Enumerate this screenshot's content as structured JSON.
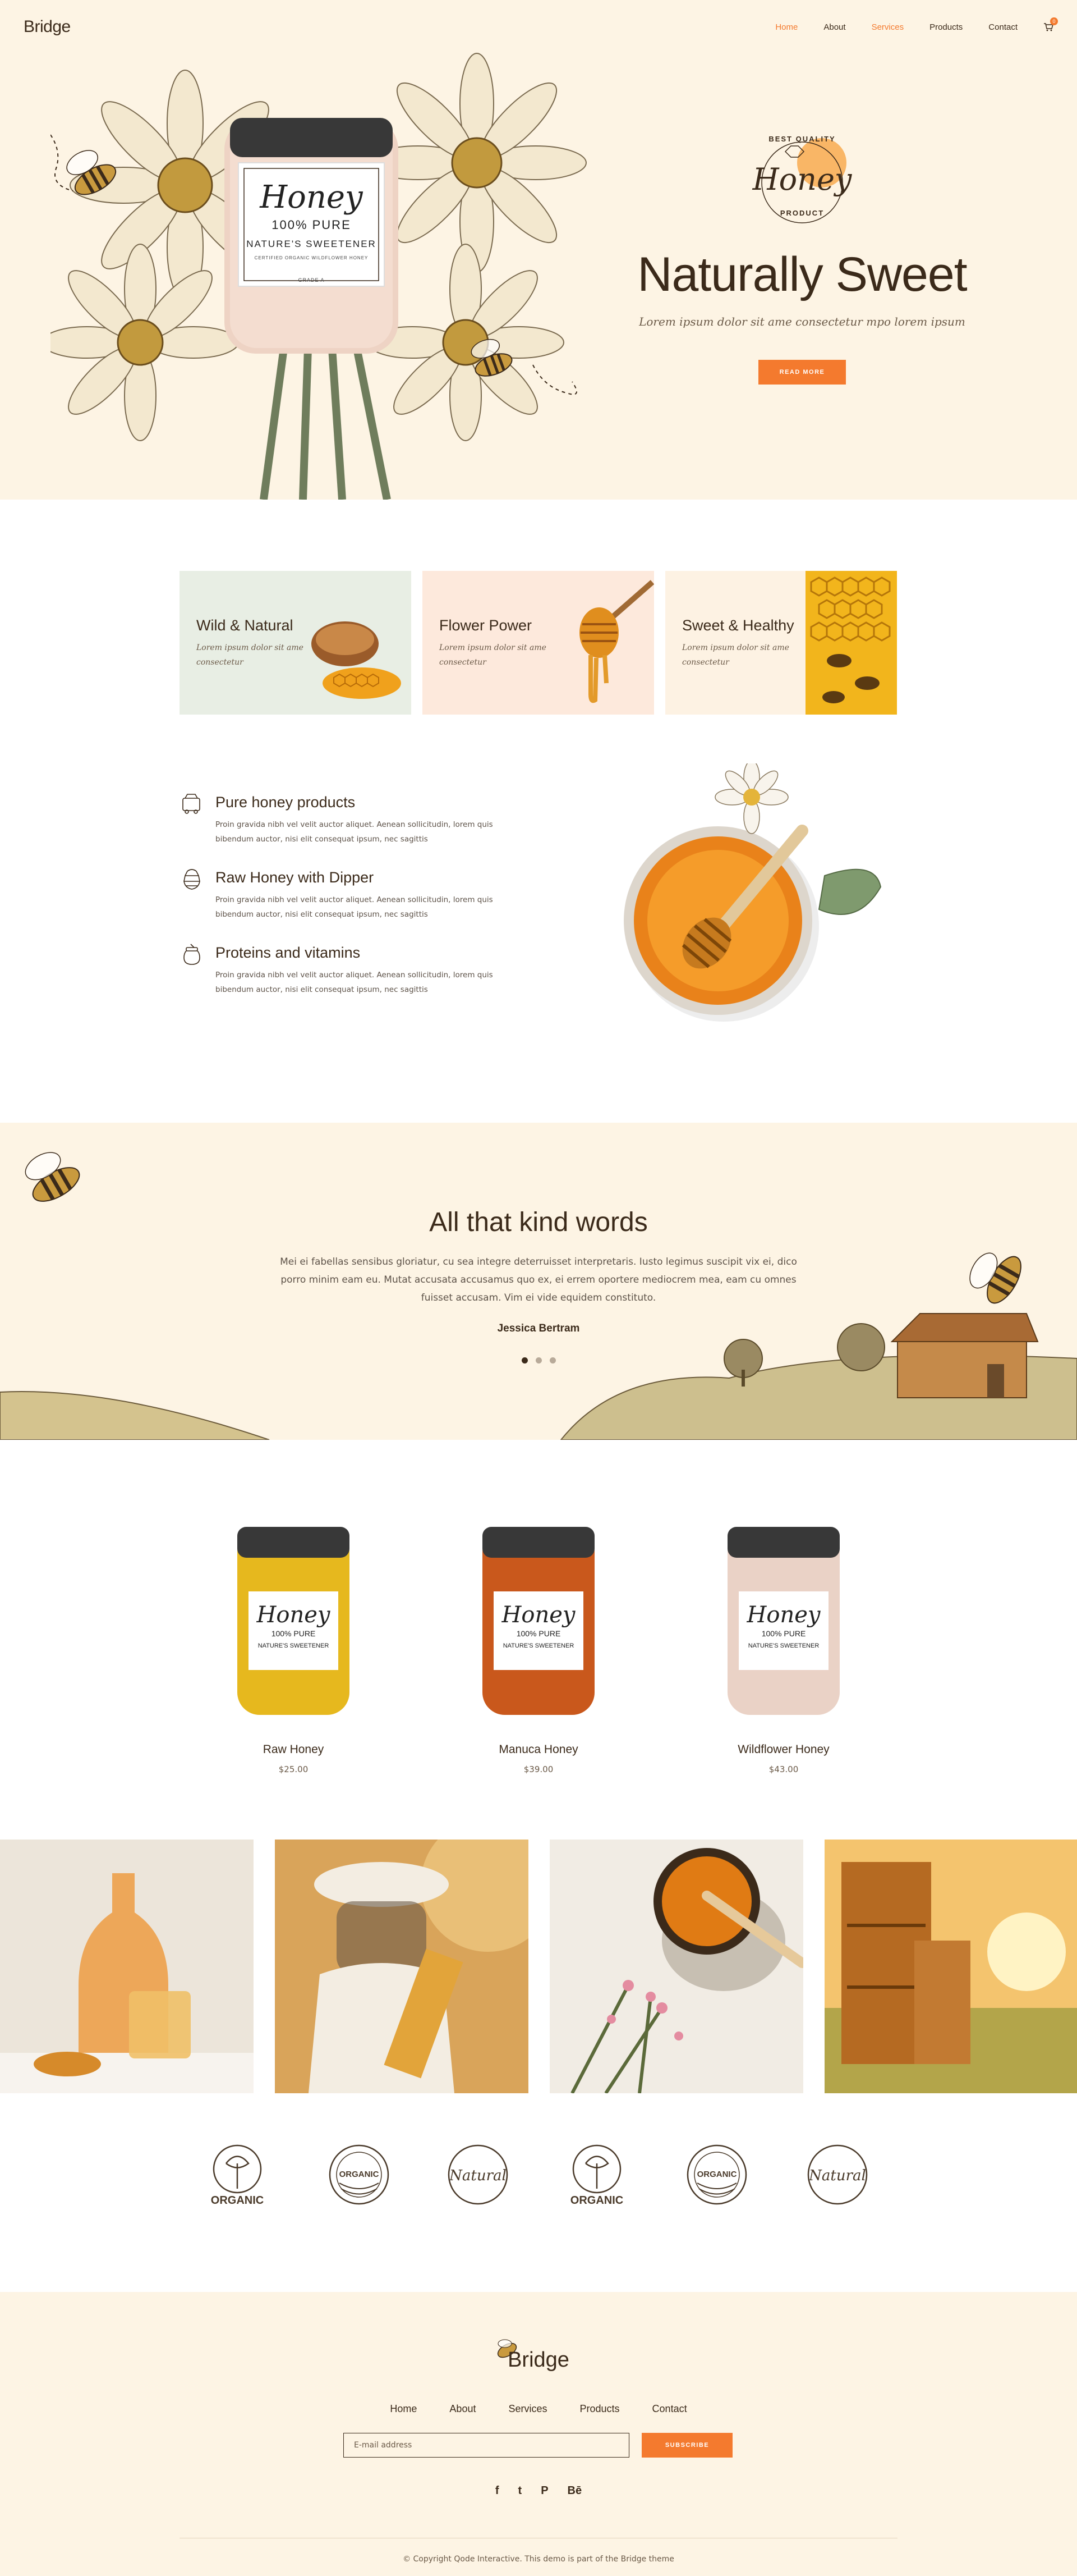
{
  "header": {
    "logo": "Bridge",
    "nav": [
      "Home",
      "About",
      "Services",
      "Products",
      "Contact"
    ],
    "cart_count": "0",
    "colors": {
      "accent": "#f47a2e",
      "text": "#3b2a1a",
      "cream": "#fdf4e4"
    }
  },
  "hero": {
    "jar": {
      "brand": "Honey",
      "line1": "100% PURE",
      "line2": "NATURE'S SWEETENER",
      "line3": "CERTIFIED ORGANIC WILDFLOWER HONEY",
      "line4": "GRADE A"
    },
    "badge": {
      "top": "BEST QUALITY",
      "middle": "Honey",
      "bottom": "PRODUCT"
    },
    "title": "Naturally Sweet",
    "subtitle": "Lorem ipsum dolor sit ame consectetur mpo lorem ipsum",
    "button": "READ MORE"
  },
  "features": [
    {
      "title": "Wild & Natural",
      "text": "Lorem ipsum dolor sit ame consectetur",
      "bg": "#e8eee4"
    },
    {
      "title": "Flower Power",
      "text": "Lorem ipsum dolor sit ame consectetur",
      "bg": "#fde9dc"
    },
    {
      "title": "Sweet & Healthy",
      "text": "Lorem ipsum dolor sit ame consectetur",
      "bg": "#fdf2e3"
    }
  ],
  "info": [
    {
      "title": "Pure honey products",
      "text": "Proin gravida nibh vel velit auctor aliquet. Aenean sollicitudin, lorem quis bibendum auctor, nisi elit consequat ipsum, nec sagittis",
      "icon": "honey-truck-icon"
    },
    {
      "title": "Raw Honey with Dipper",
      "text": "Proin gravida nibh vel velit auctor aliquet. Aenean sollicitudin, lorem quis bibendum auctor, nisi elit consequat ipsum, nec sagittis",
      "icon": "beehive-icon"
    },
    {
      "title": "Proteins and vitamins",
      "text": "Proin gravida nibh vel velit auctor aliquet. Aenean sollicitudin, lorem quis bibendum auctor, nisi elit consequat ipsum, nec sagittis",
      "icon": "honey-jar-icon"
    }
  ],
  "testimonial": {
    "title": "All that kind words",
    "text": "Mei ei fabellas sensibus gloriatur, cu sea integre deterruisset interpretaris. Iusto legimus suscipit vix ei, dico porro minim eam eu. Mutat accusata accusamus quo ex, ei errem oportere mediocrem mea, eam cu omnes fuisset accusam. Vim ei vide equidem constituto.",
    "author": "Jessica Bertram",
    "slides": 3,
    "active_slide": 1
  },
  "products": [
    {
      "name": "Raw Honey",
      "price": "$25.00",
      "color": "#e6b81e"
    },
    {
      "name": "Manuca Honey",
      "price": "$39.00",
      "color": "#c9581c"
    },
    {
      "name": "Wildflower Honey",
      "price": "$43.00",
      "color": "#ead2c6"
    }
  ],
  "jar_label": {
    "brand": "Honey",
    "line1": "100% PURE",
    "line2": "NATURE'S SWEETENER"
  },
  "brands": [
    "ORGANIC",
    "ORGANIC",
    "Natural",
    "ORGANIC",
    "ORGANIC",
    "Natural"
  ],
  "footer": {
    "logo": "Bridge",
    "nav": [
      "Home",
      "About",
      "Services",
      "Products",
      "Contact"
    ],
    "email_placeholder": "E-mail address",
    "subscribe": "SUBSCRIBE",
    "social": [
      "f",
      "t",
      "P",
      "Bē"
    ],
    "copyright": "© Copyright Qode Interactive. This demo is part of the Bridge theme"
  }
}
